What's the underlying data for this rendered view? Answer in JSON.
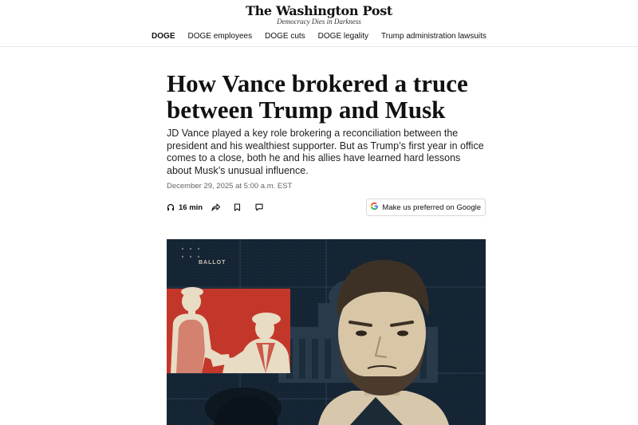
{
  "masthead": {
    "logo": "The Washington Post",
    "tagline": "Democracy Dies in Darkness"
  },
  "nav": {
    "items": [
      {
        "label": "DOGE",
        "active": true
      },
      {
        "label": "DOGE employees"
      },
      {
        "label": "DOGE cuts"
      },
      {
        "label": "DOGE legality"
      },
      {
        "label": "Trump administration lawsuits"
      }
    ]
  },
  "article": {
    "headline": "How Vance brokered a truce between Trump and Musk",
    "dek": "JD Vance played a key role brokering a reconciliation between the president and his wealthiest supporter. But as Trump’s first year in office comes to a close, both he and his allies have learned hard lessons about Musk’s unusual influence.",
    "dateline": "December 29, 2025 at 5:00 a.m. EST"
  },
  "tools": {
    "listen_label": "16 min",
    "preferred_label": "Make us preferred on Google",
    "icons": [
      "headphones-icon",
      "share-icon",
      "bookmark-icon",
      "comment-icon",
      "google-g-icon"
    ]
  },
  "hero": {
    "ballot_text": "BALLOT"
  },
  "colors": {
    "hero_background": "#152433",
    "hero_red": "#c3372a",
    "hero_cream": "#e8dcc4",
    "google_blue": "#4285f4",
    "google_red": "#ea4335",
    "google_yellow": "#fbbc05",
    "google_green": "#34a853"
  }
}
